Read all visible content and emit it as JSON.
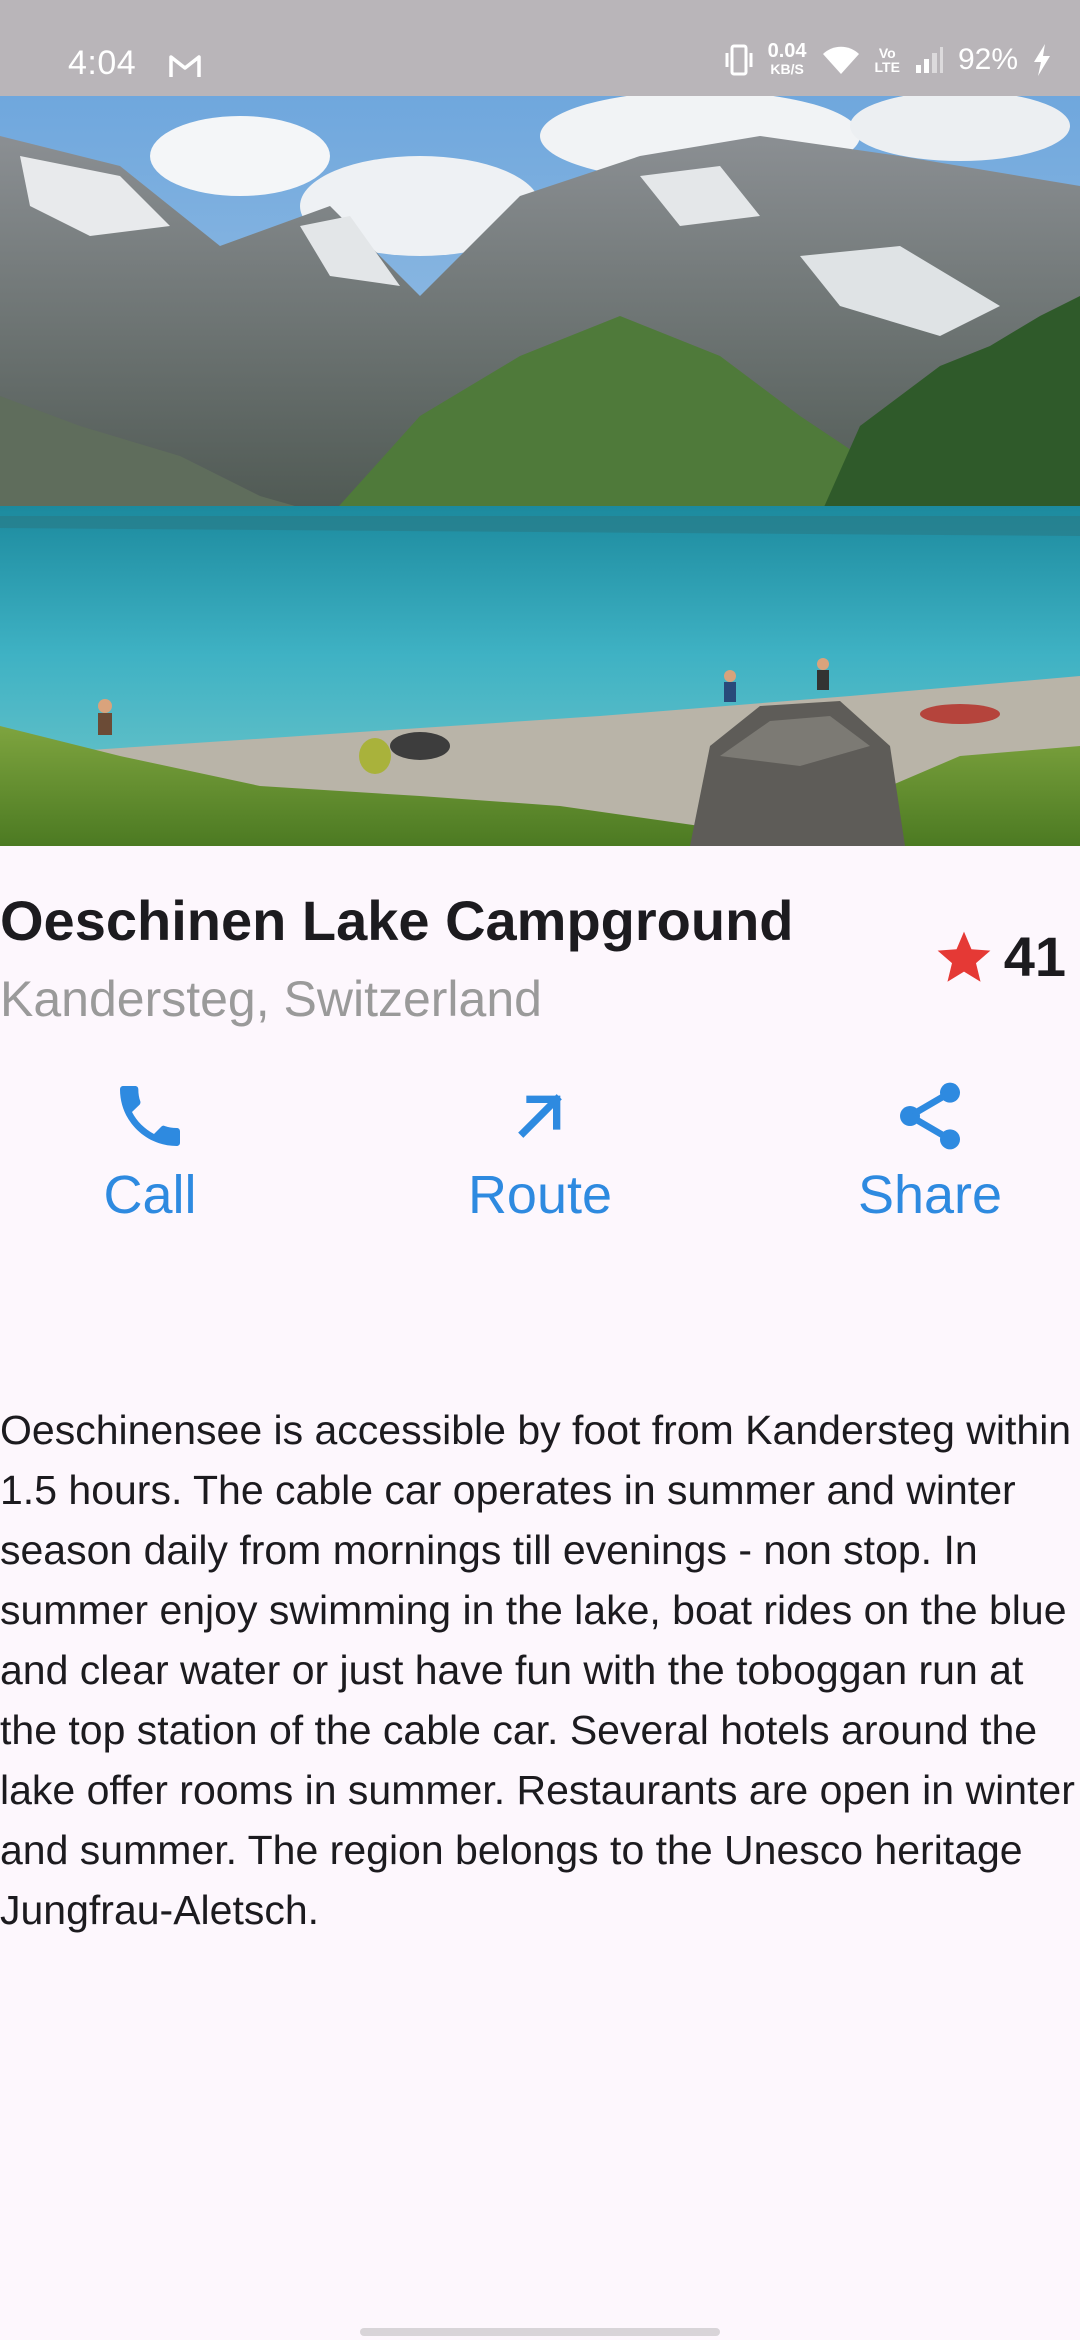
{
  "status_bar": {
    "time": "4:04",
    "net_speed_value": "0.04",
    "net_speed_unit": "KB/S",
    "lte_top": "Vo",
    "lte_bottom": "LTE",
    "battery": "92%"
  },
  "place": {
    "name": "Oeschinen Lake Campground",
    "location": "Kandersteg, Switzerland",
    "rating_count": "41"
  },
  "actions": {
    "call_label": "Call",
    "route_label": "Route",
    "share_label": "Share"
  },
  "description": "Oeschinensee is accessible by foot from Kandersteg within 1.5 hours. The cable car operates in summer and winter season daily from mornings till evenings - non stop. In summer enjoy swimming in the lake, boat rides on the blue and clear water or just have fun with the toboggan run at the top station of the cable car. Several hotels around the lake offer rooms in summer. Restaurants are open in winter and summer. The region belongs to the Unesco heritage Jungfrau-Aletsch.",
  "colors": {
    "accent": "#2e8ae0",
    "star": "#e53935",
    "background": "#fdf7fd",
    "subtitle": "#9a9a9a"
  },
  "icons": [
    "gmail-icon",
    "vibrate-icon",
    "wifi-icon",
    "signal-icon",
    "charging-icon",
    "star-icon",
    "phone-icon",
    "arrow-up-right-icon",
    "share-icon"
  ]
}
